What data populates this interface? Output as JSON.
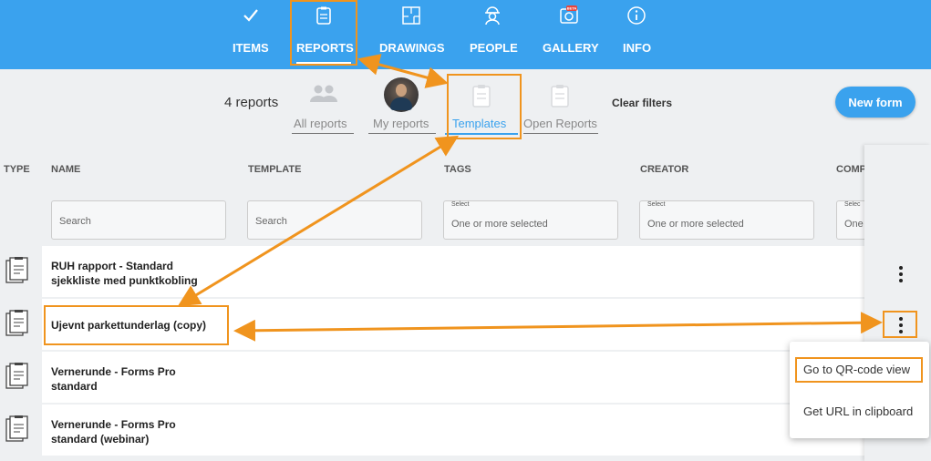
{
  "nav": {
    "items": [
      {
        "label": "ITEMS",
        "icon": "checkmark-icon"
      },
      {
        "label": "REPORTS",
        "icon": "clipboard-icon"
      },
      {
        "label": "DRAWINGS",
        "icon": "floorplan-icon"
      },
      {
        "label": "PEOPLE",
        "icon": "worker-icon"
      },
      {
        "label": "GALLERY",
        "icon": "camera-icon",
        "badge": "BETA"
      },
      {
        "label": "INFO",
        "icon": "info-icon"
      }
    ],
    "active": "REPORTS"
  },
  "filters": {
    "count_text": "4 reports",
    "items": [
      {
        "label": "All reports",
        "icon": "people-icon"
      },
      {
        "label": "My reports",
        "icon": "avatar"
      },
      {
        "label": "Templates",
        "icon": "template-icon",
        "selected": true
      },
      {
        "label": "Open Reports",
        "icon": "open-report-icon"
      }
    ],
    "clear_label": "Clear filters"
  },
  "new_form_label": "New form",
  "table": {
    "headers": {
      "type": "TYPE",
      "name": "NAME",
      "template": "TEMPLATE",
      "tags": "TAGS",
      "creator": "CREATOR",
      "comp": "COMP"
    },
    "name_search_placeholder": "Search",
    "template_search_placeholder": "Search",
    "tags_select_label": "Select",
    "tags_select_value": "One or more selected",
    "creator_select_label": "Select",
    "creator_select_value": "One or more selected",
    "comp_select_label": "Selec",
    "comp_select_value": "One",
    "rows": [
      {
        "name_line1": "RUH rapport - Standard",
        "name_line2": "sjekkliste med punktkobling"
      },
      {
        "name_line1": "Ujevnt parkettunderlag (copy)",
        "name_line2": ""
      },
      {
        "name_line1": "Vernerunde - Forms Pro",
        "name_line2": "standard"
      },
      {
        "name_line1": "Vernerunde - Forms Pro",
        "name_line2": "standard (webinar)"
      }
    ]
  },
  "context_menu": {
    "items": [
      "Go to QR-code view",
      "Get URL in clipboard"
    ]
  },
  "colors": {
    "brand": "#3aa2ee",
    "highlight": "#f0941e"
  }
}
